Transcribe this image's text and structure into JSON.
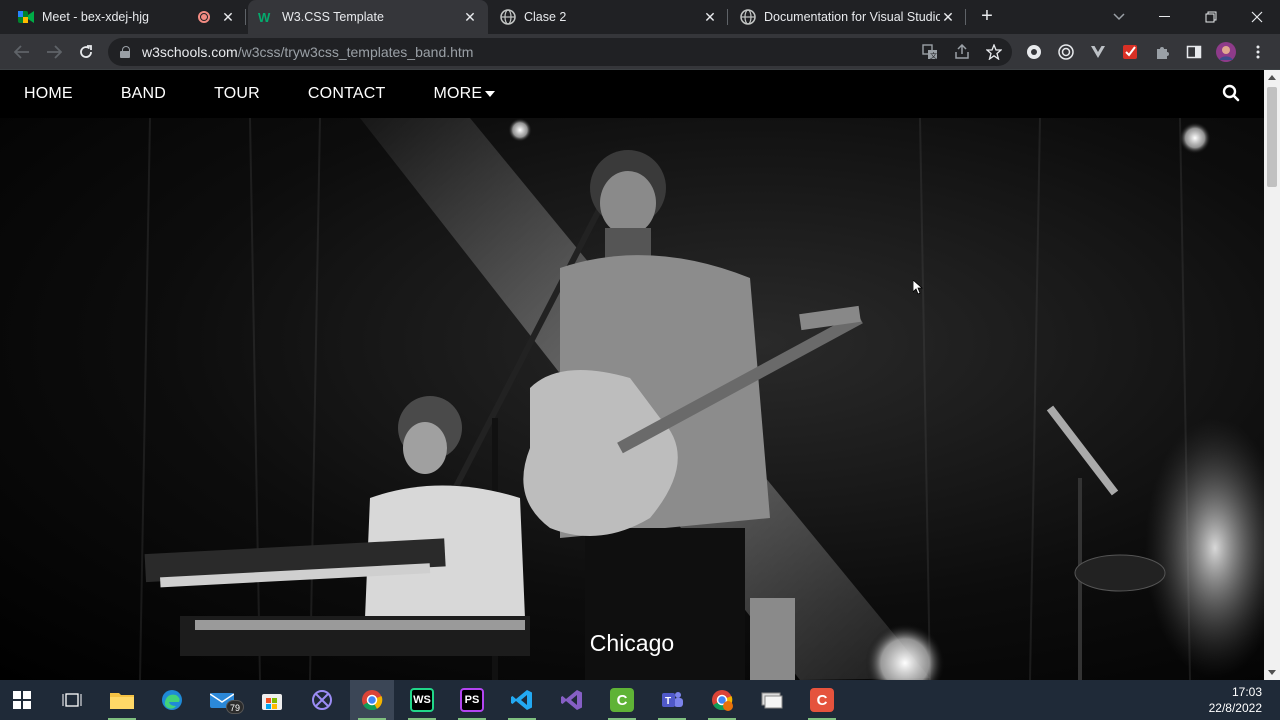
{
  "browser": {
    "tabs": [
      {
        "title": "Meet - bex-xdej-hjg",
        "icon": "google-meet-icon",
        "recording": true,
        "active": false
      },
      {
        "title": "W3.CSS Template",
        "icon": "w3schools-icon",
        "active": true
      },
      {
        "title": "Clase 2",
        "icon": "globe-icon",
        "active": false
      },
      {
        "title": "Documentation for Visual Studio",
        "icon": "globe-icon",
        "active": false
      }
    ],
    "new_tab_label": "+",
    "url_host": "w3schools.com",
    "url_path": "/w3css/tryw3css_templates_band.htm"
  },
  "navbar": {
    "items": [
      "HOME",
      "BAND",
      "TOUR",
      "CONTACT",
      "MORE"
    ],
    "more_has_dropdown": true,
    "search_icon": "search-icon"
  },
  "hero": {
    "caption": "Chicago"
  },
  "taskbar": {
    "mail_badge": "79",
    "time": "17:03",
    "date": "22/8/2022"
  }
}
